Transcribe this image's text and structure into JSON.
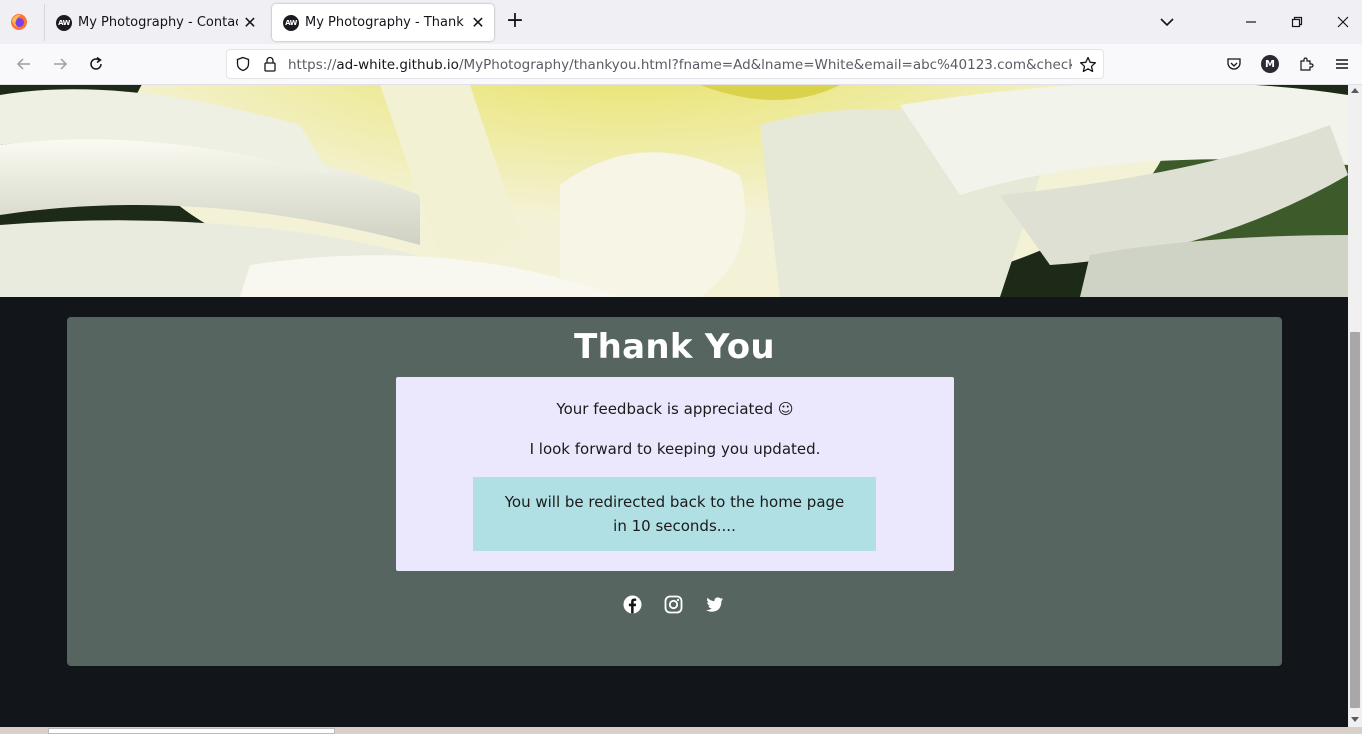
{
  "browser": {
    "tabs": [
      {
        "title": "My Photography - Contact",
        "favicon": "AW",
        "active": false
      },
      {
        "title": "My Photography - Thank You",
        "favicon": "AW",
        "active": true
      }
    ],
    "url_host": "ad-white.github.io",
    "url_scheme": "https://",
    "url_path": "/MyPhotography/thankyou.html?fname=Ad&lname=White&email=abc%40123.com&checkbox=on&c",
    "profile_initial": "M"
  },
  "page": {
    "heading": "Thank You",
    "feedback_text": "Your feedback is appreciated ☺",
    "forward_text": "I look forward to keeping you updated.",
    "redirect_text": "You will be redirected back to the home page in 10 seconds....",
    "socials": [
      "facebook-icon",
      "instagram-icon",
      "twitter-icon"
    ]
  },
  "colors": {
    "page_bg": "#12151a",
    "card_bg": "#566560",
    "panel_bg": "#ebe7fc",
    "redirect_bg": "#b0e0e4"
  }
}
